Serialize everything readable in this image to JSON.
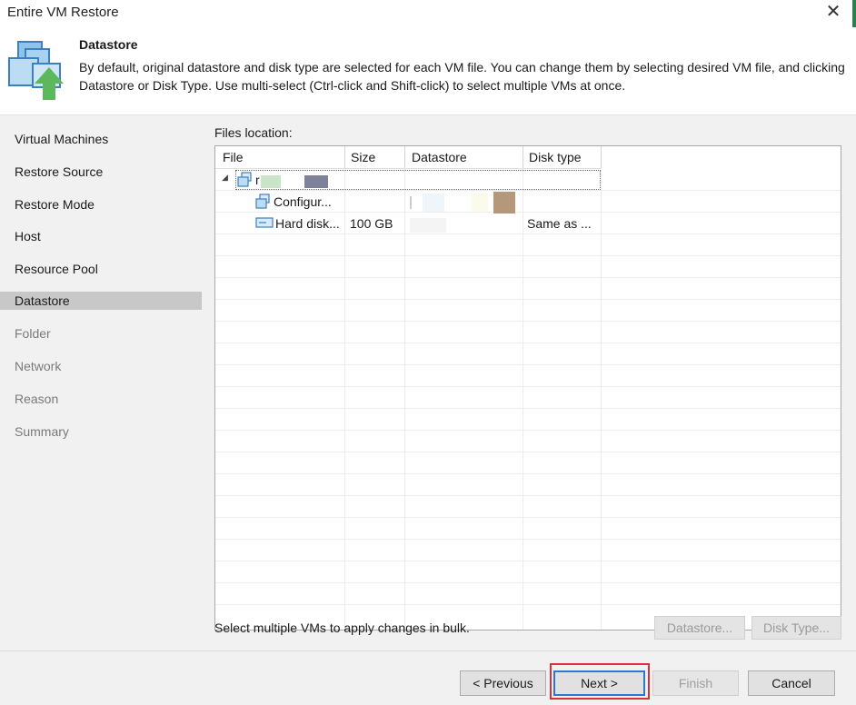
{
  "window": {
    "title": "Entire VM Restore"
  },
  "header": {
    "title": "Datastore",
    "description": "By default, original datastore and disk type are selected for each VM file. You can change them by selecting desired VM file, and clicking Datastore or Disk Type. Use multi-select (Ctrl-click and Shift-click) to select multiple VMs at once."
  },
  "sidebar": {
    "items": [
      {
        "label": "Virtual Machines",
        "state": "done"
      },
      {
        "label": "Restore Source",
        "state": "done"
      },
      {
        "label": "Restore Mode",
        "state": "done"
      },
      {
        "label": "Host",
        "state": "done"
      },
      {
        "label": "Resource Pool",
        "state": "done"
      },
      {
        "label": "Datastore",
        "state": "active"
      },
      {
        "label": "Folder",
        "state": "disabled"
      },
      {
        "label": "Network",
        "state": "disabled"
      },
      {
        "label": "Reason",
        "state": "disabled"
      },
      {
        "label": "Summary",
        "state": "disabled"
      }
    ]
  },
  "files": {
    "label": "Files location:",
    "columns": [
      "File",
      "Size",
      "Datastore",
      "Disk type"
    ],
    "rows": [
      {
        "name": "r",
        "size": "",
        "datastore": "",
        "disk_type": "",
        "icon": "vm-icon",
        "level": 0
      },
      {
        "name": "Configur...",
        "size": "",
        "datastore": "",
        "disk_type": "",
        "icon": "config-icon",
        "level": 1
      },
      {
        "name": "Hard disk...",
        "size": "100 GB",
        "datastore": "",
        "disk_type": "Same as ...",
        "icon": "disk-icon",
        "level": 1
      }
    ],
    "hint": "Select multiple VMs to apply changes in bulk.",
    "datastore_button": "Datastore...",
    "disktype_button": "Disk Type..."
  },
  "footer": {
    "previous": "< Previous",
    "next": "Next >",
    "finish": "Finish",
    "cancel": "Cancel"
  },
  "colors": {
    "accent": "#2a78d6",
    "highlight": "#d9303e",
    "active_step": "#c8c8c8",
    "panel": "#f1f1f1"
  }
}
